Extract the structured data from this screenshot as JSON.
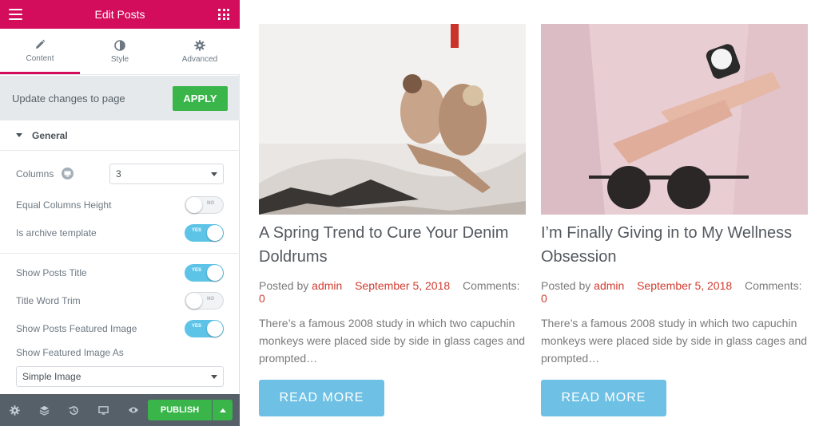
{
  "panel": {
    "title": "Edit Posts",
    "tabs": [
      {
        "label": "Content",
        "icon": "pencil-icon"
      },
      {
        "label": "Style",
        "icon": "contrast-icon"
      },
      {
        "label": "Advanced",
        "icon": "gear-icon"
      }
    ],
    "update_label": "Update changes to page",
    "apply_label": "APPLY",
    "section_title": "General",
    "controls": {
      "columns_label": "Columns",
      "columns_value": "3",
      "equal_height_label": "Equal Columns Height",
      "equal_height_state": "NO",
      "archive_label": "Is archive template",
      "archive_state": "YES",
      "show_title_label": "Show Posts Title",
      "show_title_state": "YES",
      "title_trim_label": "Title Word Trim",
      "title_trim_state": "NO",
      "show_featured_label": "Show Posts Featured Image",
      "show_featured_state": "YES",
      "featured_as_label": "Show Featured Image As",
      "featured_as_value": "Simple Image"
    },
    "footer": {
      "publish_label": "PUBLISH"
    }
  },
  "posts": [
    {
      "title": "A Spring Trend to Cure Your Denim Doldrums",
      "posted_by": "Posted by",
      "author": "admin",
      "date": "September 5, 2018",
      "comments_label": "Comments:",
      "comments_count": "0",
      "excerpt": "There’s a famous 2008 study in which two capuchin monkeys were placed side by side in glass cages and prompted…",
      "read_more": "READ MORE"
    },
    {
      "title": "I’m Finally Giving in to My Wellness Obsession",
      "posted_by": "Posted by",
      "author": "admin",
      "date": "September 5, 2018",
      "comments_label": "Comments:",
      "comments_count": "0",
      "excerpt": "There’s a famous 2008 study in which two capuchin monkeys were placed side by side in glass cages and prompted…",
      "read_more": "READ MORE"
    }
  ],
  "colors": {
    "brand": "#d30c5c",
    "apply_green": "#39b54a",
    "toggle_on": "#5dc4e8",
    "meta_red": "#d13b2f",
    "read_more": "#6ec1e4"
  }
}
